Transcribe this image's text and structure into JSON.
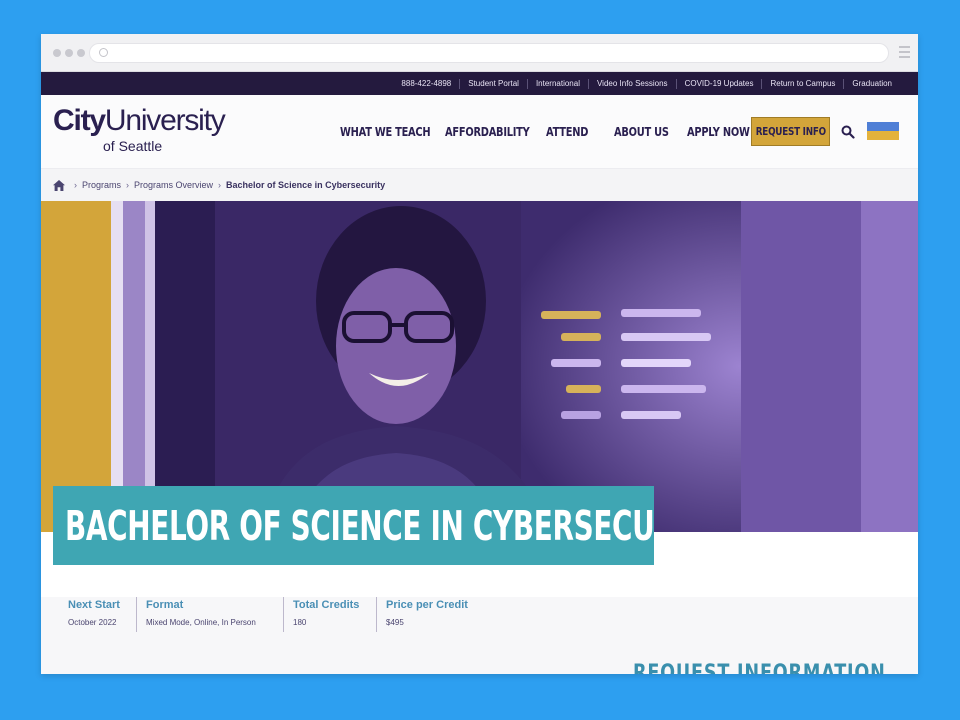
{
  "utility_links": [
    "888-422-4898",
    "Student Portal",
    "International",
    "Video Info Sessions",
    "COVID-19 Updates",
    "Return to Campus",
    "Graduation"
  ],
  "logo": {
    "main_bold": "City",
    "main_regular": "University",
    "sub": "of Seattle"
  },
  "nav": {
    "items": [
      "WHAT WE TEACH",
      "AFFORDABILITY",
      "ATTEND",
      "ABOUT US",
      "APPLY NOW"
    ],
    "request_button": "REQUEST INFO"
  },
  "breadcrumb": {
    "items": [
      "Programs",
      "Programs Overview"
    ],
    "current": "Bachelor of Science in Cybersecurity"
  },
  "hero": {
    "title": "BACHELOR OF SCIENCE IN CYBERSECURITY"
  },
  "facts": [
    {
      "label": "Next Start",
      "value": "October 2022"
    },
    {
      "label": "Format",
      "value": "Mixed Mode, Online, In Person"
    },
    {
      "label": "Total Credits",
      "value": "180"
    },
    {
      "label": "Price per Credit",
      "value": "$495"
    }
  ],
  "request_section_heading": "REQUEST INFORMATION",
  "colors": {
    "page_background": "#2d9ff0",
    "utility_bar": "#241a3e",
    "brand_navy": "#2a2050",
    "gold": "#d3a53a",
    "teal": "#3fa6b3",
    "hero_purple": "#7c5fb0"
  },
  "icons": [
    "home-icon",
    "search-icon",
    "flag-icon",
    "chevron-right-icon"
  ]
}
